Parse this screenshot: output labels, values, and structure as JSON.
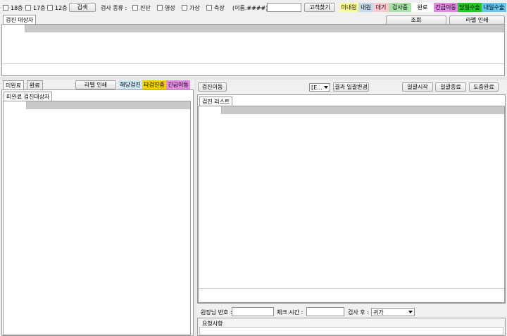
{
  "toolbar": {
    "floors": [
      {
        "label": "18층"
      },
      {
        "label": "17층"
      },
      {
        "label": "12층"
      }
    ],
    "search_button": "검색",
    "exam_type_label": "검사 종류 :",
    "exam_types": [
      {
        "label": "진단"
      },
      {
        "label": "영상"
      },
      {
        "label": "가상"
      },
      {
        "label": "측상"
      }
    ],
    "name_hint": "(이름.####)",
    "name_input_value": "",
    "customer_search_button": "고객찾기",
    "status_legend": [
      {
        "label": "미내원",
        "color": "#ffff99"
      },
      {
        "label": "내원",
        "color": "#c5d9f1"
      },
      {
        "label": "대기",
        "color": "#ffc7ce"
      },
      {
        "label": "검사중",
        "color": "#a9e2a9"
      },
      {
        "label": "완료",
        "color": "#ffffff"
      },
      {
        "label": "긴급이동",
        "color": "#e28be2"
      },
      {
        "label": "당일수술",
        "color": "#22cc22"
      },
      {
        "label": "내일수술",
        "color": "#66c6f0"
      }
    ]
  },
  "top_panel": {
    "tab_label": "검진 대상자",
    "query_button": "조회",
    "label_print_button": "라벨 인쇄"
  },
  "left_panel": {
    "tabs": [
      {
        "label": "미완료"
      },
      {
        "label": "완료"
      }
    ],
    "label_print_button": "라벨 인쇄",
    "legend": [
      {
        "label": "해당검진",
        "color": "#cfe8f6"
      },
      {
        "label": "타검진중",
        "color": "#f5d000"
      },
      {
        "label": "긴급이동",
        "color": "#e28be2"
      }
    ],
    "sub_tab_label": "미완료 검진대상자"
  },
  "right_panel": {
    "move_button": "검진이동",
    "result_select_value": "[E...",
    "batch_change_label": "결과 일괄변경",
    "batch_start_button": "일괄시작",
    "batch_end_button": "일괄종료",
    "midway_done_button": "도중완료",
    "list_tab_label": "검진 리스트",
    "doctor_no_label": "원장님 번호 :",
    "doctor_no_value": "",
    "check_time_label": "체크 시간 :",
    "check_time_value": "",
    "after_exam_label": "검사 후 :",
    "after_exam_value": "귀가",
    "request_label": "요청사항"
  }
}
